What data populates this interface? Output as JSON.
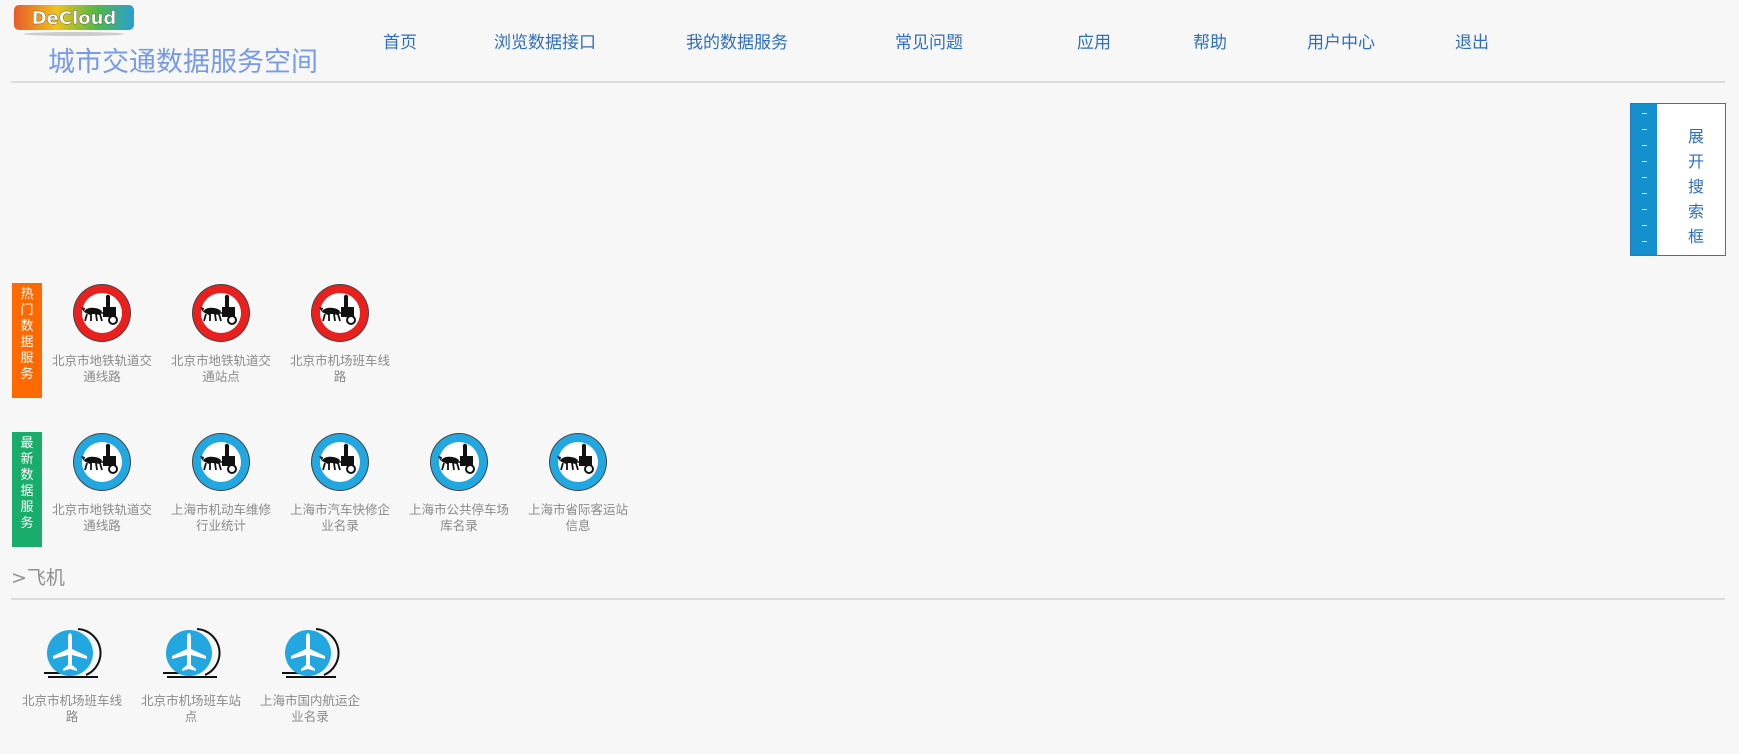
{
  "header": {
    "logo_text": "DeCloud",
    "site_title": "城市交通数据服务空间",
    "nav": [
      "首页",
      "浏览数据接口",
      "我的数据服务",
      "常见问题",
      "应用",
      "帮助",
      "用户中心",
      "退出"
    ]
  },
  "search_toggle": {
    "label": "展开搜索框",
    "chars": [
      "展",
      "开",
      "搜",
      "索",
      "框"
    ]
  },
  "hot": {
    "tag": "热门数据服务",
    "tag_chars": [
      "热",
      "门",
      "数",
      "据",
      "服",
      "务"
    ],
    "items": [
      {
        "line1": "北京市地铁轨道交",
        "line2": "通线路"
      },
      {
        "line1": "北京市地铁轨道交",
        "line2": "通站点"
      },
      {
        "line1": "北京市机场班车线",
        "line2": "路"
      }
    ]
  },
  "latest": {
    "tag": "最新数据服务",
    "tag_chars": [
      "最",
      "新",
      "数",
      "据",
      "服",
      "务"
    ],
    "items": [
      {
        "line1": "北京市地铁轨道交",
        "line2": "通线路"
      },
      {
        "line1": "上海市机动车维修",
        "line2": "行业统计"
      },
      {
        "line1": "上海市汽车快修企",
        "line2": "业名录"
      },
      {
        "line1": "上海市公共停车场",
        "line2": "库名录"
      },
      {
        "line1": "上海市省际客运站",
        "line2": "信息"
      }
    ]
  },
  "plane_section": {
    "title": ">飞机",
    "items": [
      {
        "line1": "北京市机场班车线",
        "line2": "路"
      },
      {
        "line1": "北京市机场班车站",
        "line2": "点"
      },
      {
        "line1": "上海市国内航运企",
        "line2": "业名录"
      }
    ]
  },
  "colors": {
    "hot_tag": "#ff6a00",
    "latest_tag": "#1aac6a",
    "nav": "#2d6ec4",
    "title": "#7799ee",
    "icon_blue": "#22a7e0",
    "icon_red": "#e8201e"
  },
  "icons": {
    "hot": "no-carriage-sign-icon",
    "latest": "carriage-sign-icon",
    "plane": "airplane-icon"
  }
}
